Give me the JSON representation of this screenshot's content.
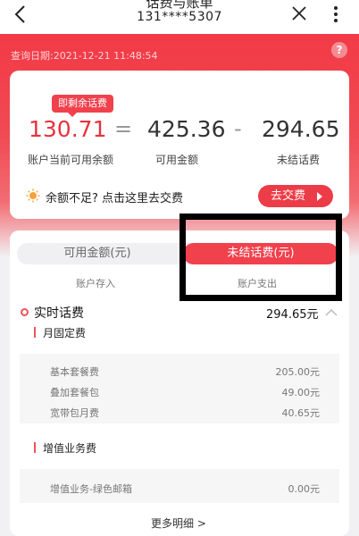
{
  "header": {
    "title": "话费与账单",
    "phone": "131****5307"
  },
  "query": {
    "label": "查询日期:2021-12-21 11:48:54",
    "help": "?"
  },
  "summary": {
    "badge": "即剩余话费",
    "balance": "130.71",
    "eq": "=",
    "available": "425.36",
    "minus": "-",
    "unsettled": "294.65",
    "balance_caption": "账户当前可用余额",
    "available_caption": "可用金额",
    "unsettled_caption": "未结话费"
  },
  "tip": {
    "text": "余额不足? 点击这里去交费",
    "button": "去交费"
  },
  "tabs": {
    "left": "可用金额(元)",
    "right": "未结话费(元)",
    "sub_left": "账户存入",
    "sub_right": "账户支出"
  },
  "realtime": {
    "title": "实时话费",
    "amount": "294.65元",
    "groups": [
      {
        "title": "月固定费",
        "rows": [
          {
            "name": "基本套餐费",
            "value": "205.00元"
          },
          {
            "name": "叠加套餐包",
            "value": "49.00元"
          },
          {
            "name": "宽带包月费",
            "value": "40.65元"
          }
        ]
      },
      {
        "title": "增值业务费",
        "rows": [
          {
            "name": "增值业务-绿色邮箱",
            "value": "0.00元"
          }
        ]
      }
    ],
    "more": "更多明细 >"
  },
  "colors": {
    "accent": "#f0414d",
    "hero": "#f23a46"
  }
}
